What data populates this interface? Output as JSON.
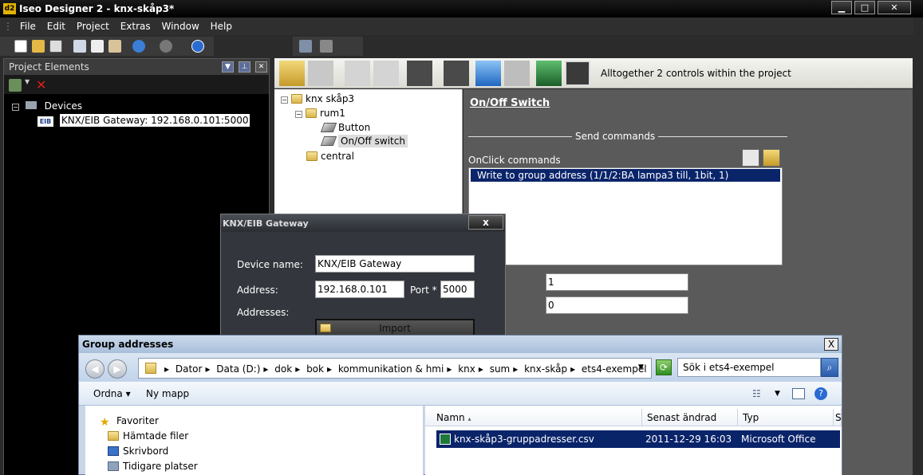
{
  "window": {
    "app_icon_text": "d2",
    "title": "Iseo Designer 2 - knx-skåp3*"
  },
  "menu": [
    "File",
    "Edit",
    "Project",
    "Extras",
    "Window",
    "Help"
  ],
  "project_panel": {
    "title": "Project Elements",
    "tree": {
      "root": "Devices",
      "device": "KNX/EIB Gateway: 192.168.0.101:5000"
    }
  },
  "main_toolbar": {
    "info": "Alltogether  2 controls within the project"
  },
  "control_tree": {
    "root": "knx skåp3",
    "room1": "rum1",
    "control1": "Button",
    "control2": "On/Off switch",
    "room2": "central"
  },
  "properties": {
    "heading": "On/Off Switch",
    "send_commands": "Send commands",
    "onclick_label": "OnClick commands",
    "command": "Write to group address (1/1/2:BA lampa3 till, 1bit, 1)",
    "field1_value": "1",
    "field2_value": "0"
  },
  "knx_dialog": {
    "title": "KNX/EIB Gateway",
    "close": "x",
    "device_name_label": "Device name:",
    "device_name_value": "KNX/EIB Gateway",
    "address_label": "Address:",
    "address_value": "192.168.0.101",
    "port_label": "Port *",
    "port_value": "5000",
    "addresses_label": "Addresses:",
    "import_label": "Import"
  },
  "ga_dialog": {
    "title": "Group addresses",
    "close": "X",
    "breadcrumb": [
      "Dator",
      "Data (D:)",
      "dok",
      "bok",
      "kommunikation & hmi",
      "knx",
      "sum",
      "knx-skåp",
      "ets4-exempel"
    ],
    "search_placeholder": "Sök i ets4-exempel",
    "organize": "Ordna",
    "new_folder": "Ny mapp",
    "favorites": [
      "Favoriter",
      "Hämtade filer",
      "Skrivbord",
      "Tidigare platser"
    ],
    "columns": [
      "Namn",
      "Senast ändrad",
      "Typ",
      "S"
    ],
    "file": {
      "name": "knx-skåp3-gruppadresser.csv",
      "modified": "2011-12-29 16:03",
      "type": "Microsoft Office Exc..."
    }
  }
}
